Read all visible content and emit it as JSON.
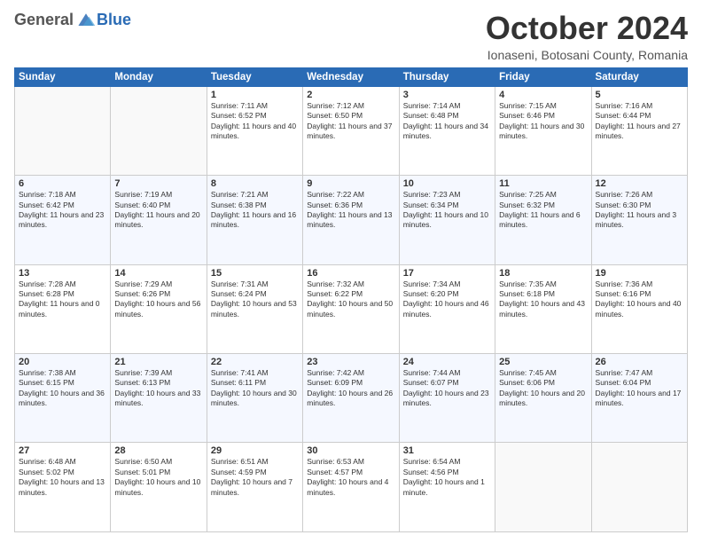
{
  "header": {
    "logo_general": "General",
    "logo_blue": "Blue",
    "month_title": "October 2024",
    "location": "Ionaseni, Botosani County, Romania"
  },
  "weekdays": [
    "Sunday",
    "Monday",
    "Tuesday",
    "Wednesday",
    "Thursday",
    "Friday",
    "Saturday"
  ],
  "weeks": [
    [
      {
        "day": "",
        "info": ""
      },
      {
        "day": "",
        "info": ""
      },
      {
        "day": "1",
        "info": "Sunrise: 7:11 AM\nSunset: 6:52 PM\nDaylight: 11 hours and 40 minutes."
      },
      {
        "day": "2",
        "info": "Sunrise: 7:12 AM\nSunset: 6:50 PM\nDaylight: 11 hours and 37 minutes."
      },
      {
        "day": "3",
        "info": "Sunrise: 7:14 AM\nSunset: 6:48 PM\nDaylight: 11 hours and 34 minutes."
      },
      {
        "day": "4",
        "info": "Sunrise: 7:15 AM\nSunset: 6:46 PM\nDaylight: 11 hours and 30 minutes."
      },
      {
        "day": "5",
        "info": "Sunrise: 7:16 AM\nSunset: 6:44 PM\nDaylight: 11 hours and 27 minutes."
      }
    ],
    [
      {
        "day": "6",
        "info": "Sunrise: 7:18 AM\nSunset: 6:42 PM\nDaylight: 11 hours and 23 minutes."
      },
      {
        "day": "7",
        "info": "Sunrise: 7:19 AM\nSunset: 6:40 PM\nDaylight: 11 hours and 20 minutes."
      },
      {
        "day": "8",
        "info": "Sunrise: 7:21 AM\nSunset: 6:38 PM\nDaylight: 11 hours and 16 minutes."
      },
      {
        "day": "9",
        "info": "Sunrise: 7:22 AM\nSunset: 6:36 PM\nDaylight: 11 hours and 13 minutes."
      },
      {
        "day": "10",
        "info": "Sunrise: 7:23 AM\nSunset: 6:34 PM\nDaylight: 11 hours and 10 minutes."
      },
      {
        "day": "11",
        "info": "Sunrise: 7:25 AM\nSunset: 6:32 PM\nDaylight: 11 hours and 6 minutes."
      },
      {
        "day": "12",
        "info": "Sunrise: 7:26 AM\nSunset: 6:30 PM\nDaylight: 11 hours and 3 minutes."
      }
    ],
    [
      {
        "day": "13",
        "info": "Sunrise: 7:28 AM\nSunset: 6:28 PM\nDaylight: 11 hours and 0 minutes."
      },
      {
        "day": "14",
        "info": "Sunrise: 7:29 AM\nSunset: 6:26 PM\nDaylight: 10 hours and 56 minutes."
      },
      {
        "day": "15",
        "info": "Sunrise: 7:31 AM\nSunset: 6:24 PM\nDaylight: 10 hours and 53 minutes."
      },
      {
        "day": "16",
        "info": "Sunrise: 7:32 AM\nSunset: 6:22 PM\nDaylight: 10 hours and 50 minutes."
      },
      {
        "day": "17",
        "info": "Sunrise: 7:34 AM\nSunset: 6:20 PM\nDaylight: 10 hours and 46 minutes."
      },
      {
        "day": "18",
        "info": "Sunrise: 7:35 AM\nSunset: 6:18 PM\nDaylight: 10 hours and 43 minutes."
      },
      {
        "day": "19",
        "info": "Sunrise: 7:36 AM\nSunset: 6:16 PM\nDaylight: 10 hours and 40 minutes."
      }
    ],
    [
      {
        "day": "20",
        "info": "Sunrise: 7:38 AM\nSunset: 6:15 PM\nDaylight: 10 hours and 36 minutes."
      },
      {
        "day": "21",
        "info": "Sunrise: 7:39 AM\nSunset: 6:13 PM\nDaylight: 10 hours and 33 minutes."
      },
      {
        "day": "22",
        "info": "Sunrise: 7:41 AM\nSunset: 6:11 PM\nDaylight: 10 hours and 30 minutes."
      },
      {
        "day": "23",
        "info": "Sunrise: 7:42 AM\nSunset: 6:09 PM\nDaylight: 10 hours and 26 minutes."
      },
      {
        "day": "24",
        "info": "Sunrise: 7:44 AM\nSunset: 6:07 PM\nDaylight: 10 hours and 23 minutes."
      },
      {
        "day": "25",
        "info": "Sunrise: 7:45 AM\nSunset: 6:06 PM\nDaylight: 10 hours and 20 minutes."
      },
      {
        "day": "26",
        "info": "Sunrise: 7:47 AM\nSunset: 6:04 PM\nDaylight: 10 hours and 17 minutes."
      }
    ],
    [
      {
        "day": "27",
        "info": "Sunrise: 6:48 AM\nSunset: 5:02 PM\nDaylight: 10 hours and 13 minutes."
      },
      {
        "day": "28",
        "info": "Sunrise: 6:50 AM\nSunset: 5:01 PM\nDaylight: 10 hours and 10 minutes."
      },
      {
        "day": "29",
        "info": "Sunrise: 6:51 AM\nSunset: 4:59 PM\nDaylight: 10 hours and 7 minutes."
      },
      {
        "day": "30",
        "info": "Sunrise: 6:53 AM\nSunset: 4:57 PM\nDaylight: 10 hours and 4 minutes."
      },
      {
        "day": "31",
        "info": "Sunrise: 6:54 AM\nSunset: 4:56 PM\nDaylight: 10 hours and 1 minute."
      },
      {
        "day": "",
        "info": ""
      },
      {
        "day": "",
        "info": ""
      }
    ]
  ]
}
